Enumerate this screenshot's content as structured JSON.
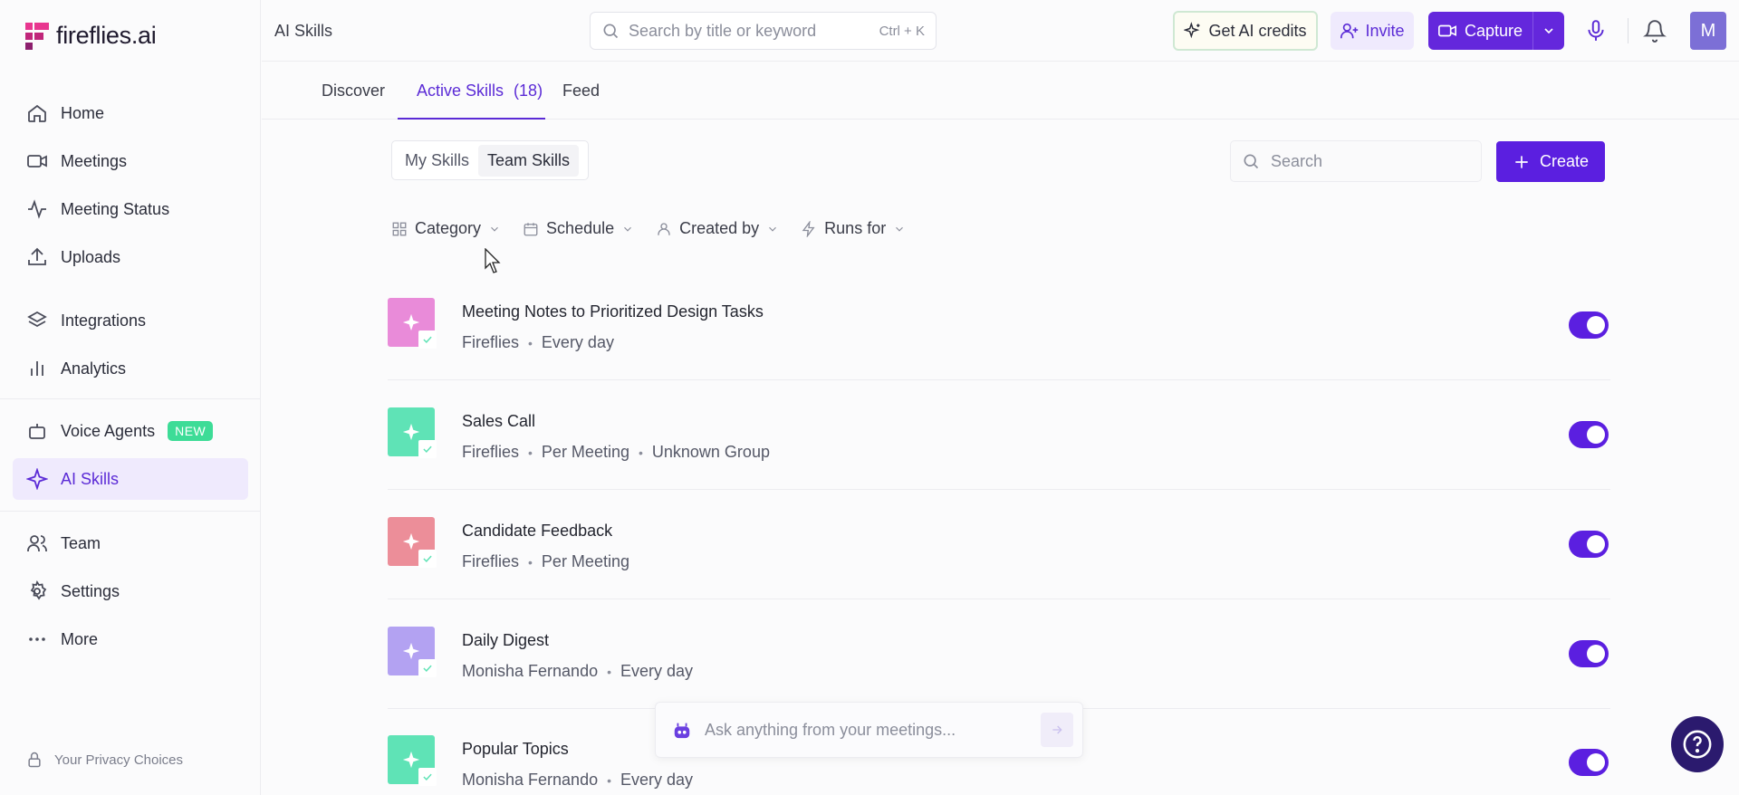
{
  "app": {
    "name": "fireflies.ai"
  },
  "sidebar": {
    "group1": [
      {
        "label": "Home",
        "icon": "home-icon"
      },
      {
        "label": "Meetings",
        "icon": "video-icon"
      },
      {
        "label": "Meeting Status",
        "icon": "activity-icon"
      },
      {
        "label": "Uploads",
        "icon": "upload-icon"
      }
    ],
    "group2": [
      {
        "label": "Integrations",
        "icon": "layers-icon"
      },
      {
        "label": "Analytics",
        "icon": "bar-chart-icon"
      }
    ],
    "group3": [
      {
        "label": "Voice Agents",
        "icon": "bot-icon",
        "badge": "NEW"
      },
      {
        "label": "AI Skills",
        "icon": "sparkle-icon",
        "active": true
      }
    ],
    "group4": [
      {
        "label": "Team",
        "icon": "users-icon"
      },
      {
        "label": "Settings",
        "icon": "gear-icon"
      },
      {
        "label": "More",
        "icon": "more-icon"
      }
    ],
    "privacy": "Your Privacy Choices"
  },
  "topbar": {
    "title": "AI Skills",
    "search_placeholder": "Search by title or keyword",
    "search_shortcut": "Ctrl + K",
    "credits_label": "Get AI credits",
    "invite_label": "Invite",
    "capture_label": "Capture",
    "avatar_initial": "M"
  },
  "tabs": [
    {
      "label": "Discover"
    },
    {
      "label": "Active Skills",
      "count": "(18)",
      "active": true
    },
    {
      "label": "Feed"
    }
  ],
  "segment": {
    "items": [
      "My Skills",
      "Team Skills"
    ],
    "active": "Team Skills"
  },
  "content": {
    "search_placeholder": "Search",
    "create_label": "Create"
  },
  "filters": [
    {
      "label": "Category",
      "icon": "grid-icon"
    },
    {
      "label": "Schedule",
      "icon": "calendar-icon"
    },
    {
      "label": "Created by",
      "icon": "user-icon"
    },
    {
      "label": "Runs for",
      "icon": "bolt-icon"
    }
  ],
  "skills": [
    {
      "title": "Meeting Notes to Prioritized Design Tasks",
      "meta": [
        "Fireflies",
        "Every day"
      ],
      "color": "#e98bd9",
      "enabled": true
    },
    {
      "title": "Sales Call",
      "meta": [
        "Fireflies",
        "Per Meeting",
        "Unknown Group"
      ],
      "color": "#5fe3b6",
      "enabled": true
    },
    {
      "title": "Candidate Feedback",
      "meta": [
        "Fireflies",
        "Per Meeting"
      ],
      "color": "#ec8e99",
      "enabled": true
    },
    {
      "title": "Daily Digest",
      "meta": [
        "Monisha Fernando",
        "Every day"
      ],
      "color": "#b3a2f2",
      "enabled": true
    },
    {
      "title": "Popular Topics",
      "meta": [
        "Monisha Fernando",
        "Every day"
      ],
      "color": "#5fe3b6",
      "enabled": true
    }
  ],
  "ask": {
    "placeholder": "Ask anything from your meetings..."
  },
  "colors": {
    "accent": "#5b1fe0",
    "accent_light": "#efeafd",
    "new_badge": "#3ddc97",
    "help": "#2b1a6e"
  }
}
